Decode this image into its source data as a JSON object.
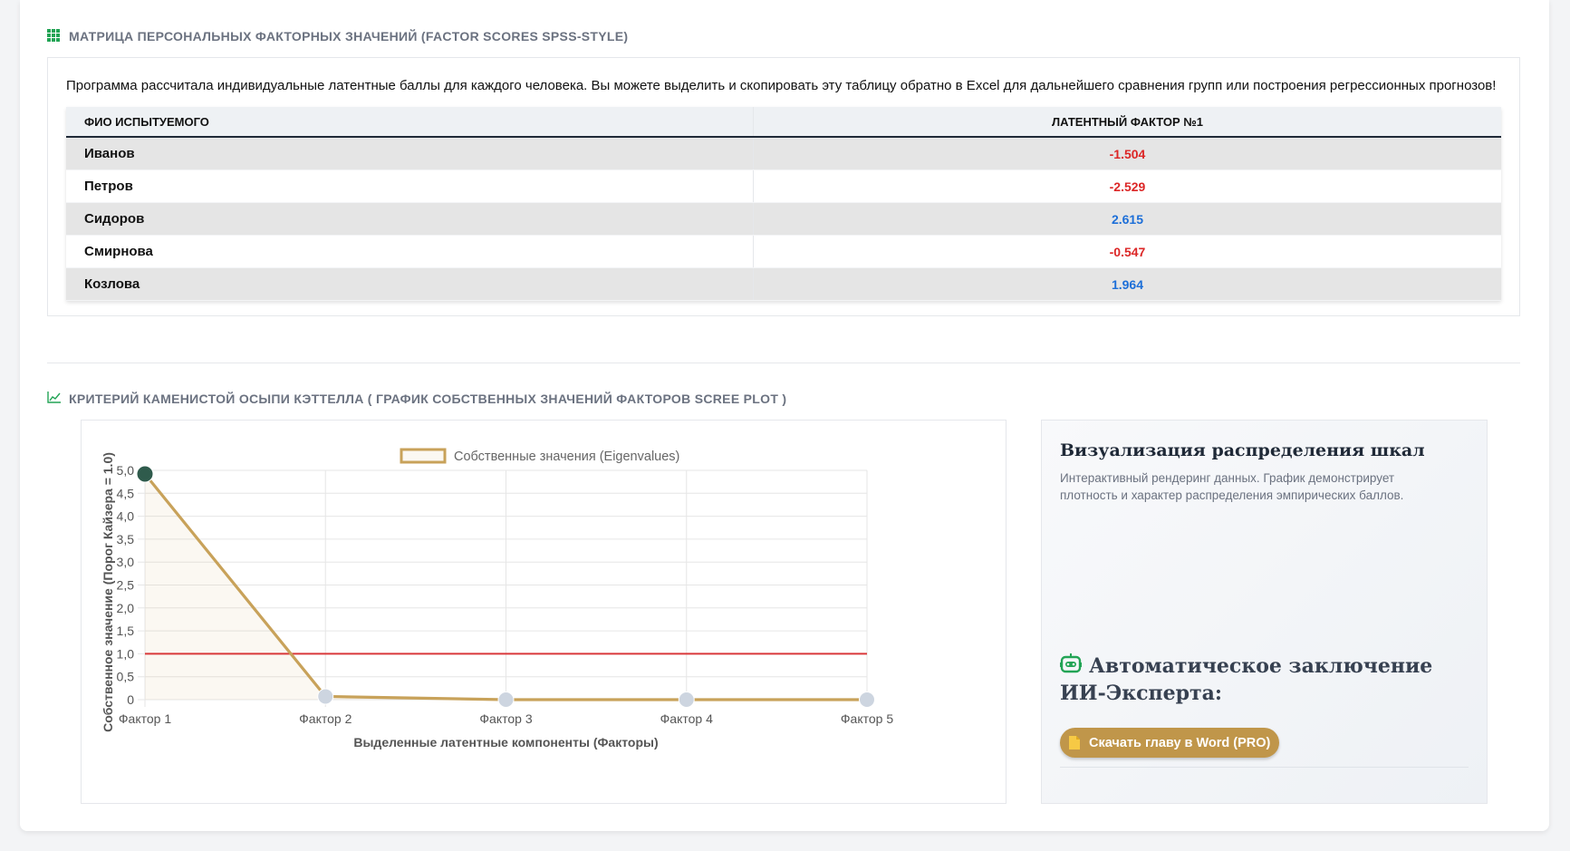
{
  "matrix": {
    "title": "МАТРИЦА ПЕРСОНАЛЬНЫХ ФАКТОРНЫХ ЗНАЧЕНИЙ (FACTOR SCORES SPSS-STYLE)",
    "icon": "grid-icon",
    "description": "Программа рассчитала индивидуальные латентные баллы для каждого человека. Вы можете выделить и скопировать эту таблицу обратно в Excel для дальнейшего сравнения групп или построения регрессионных прогнозов!",
    "columns": [
      "ФИО ИСПЫТУЕМОГО",
      "ЛАТЕНТНЫЙ ФАКТОР №1"
    ],
    "rows": [
      {
        "name": "Иванов",
        "score": "-1.504"
      },
      {
        "name": "Петров",
        "score": "-2.529"
      },
      {
        "name": "Сидоров",
        "score": "2.615"
      },
      {
        "name": "Смирнова",
        "score": "-0.547"
      },
      {
        "name": "Козлова",
        "score": "1.964"
      }
    ],
    "colors": {
      "negative": "#dc2626",
      "positive": "#1d6fd8"
    }
  },
  "scree": {
    "title": "КРИТЕРИЙ КАМЕНИСТОЙ ОСЫПИ КЭТТЕЛЛА ( ГРАФИК СОБСТВЕННЫХ ЗНАЧЕНИЙ ФАКТОРОВ SCREE PLOT )",
    "icon": "line-chart-icon"
  },
  "chart_data": {
    "type": "line",
    "categories": [
      "Фактор 1",
      "Фактор 2",
      "Фактор 3",
      "Фактор 4",
      "Фактор 5"
    ],
    "series": [
      {
        "name": "Собственные значения (Eigenvalues)",
        "values": [
          4.92,
          0.07,
          0.0,
          0.0,
          0.0
        ],
        "color": "#c8a25a"
      }
    ],
    "reference_line": {
      "y": 1.0,
      "color": "#d9383a"
    },
    "xlabel": "Выделенные латентные компоненты (Факторы)",
    "ylabel": "Собственное значение (Порог Кайзера = 1.0)",
    "ylim": [
      0,
      5
    ],
    "yticks": [
      "0",
      "0,5",
      "1,0",
      "1,5",
      "2,0",
      "2,5",
      "3,0",
      "3,5",
      "4,0",
      "4,5",
      "5,0"
    ],
    "grid": true,
    "legend_position": "top-center"
  },
  "side_panel": {
    "title": "Визуализация распределения шкал",
    "description": "Интерактивный рендеринг данных. График демонстрирует плотность и характер распределения эмпирических баллов.",
    "ai_heading": "Автоматическое заключение ИИ-Эксперта:",
    "ai_icon": "robot-icon",
    "download_label": "Скачать главу в Word (PRO)",
    "download_icon": "document-icon",
    "accent": "#c0964a"
  }
}
